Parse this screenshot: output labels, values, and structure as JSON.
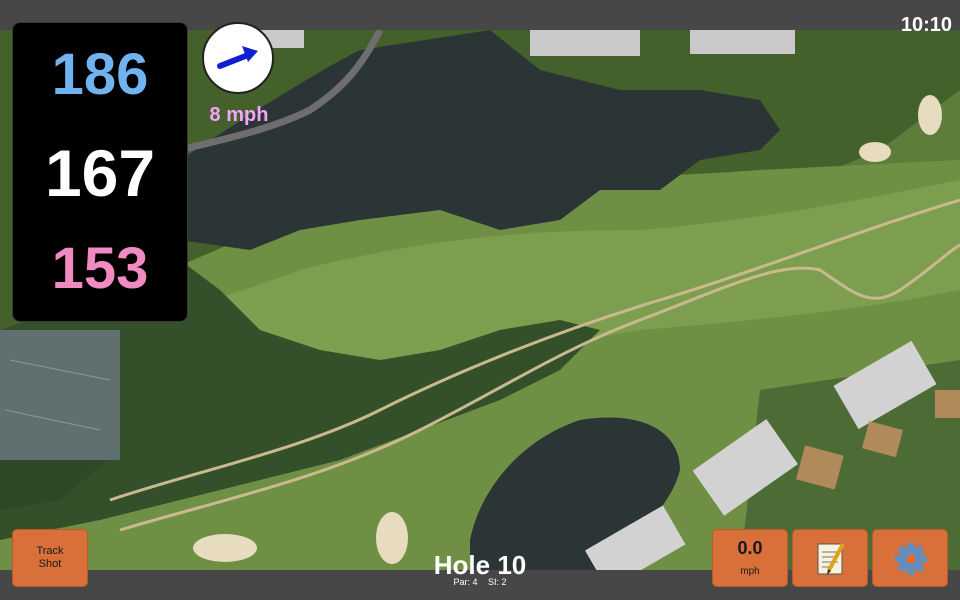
{
  "status": {
    "time": "10:10"
  },
  "distances": {
    "back": "186",
    "center": "167",
    "front": "153"
  },
  "wind": {
    "speed_label": "8 mph",
    "icon": "wind-direction-arrow-icon"
  },
  "buttons": {
    "track_shot": "Track\nShot",
    "wind_value": "0.0",
    "wind_unit": "mph",
    "notes_icon": "notepad-icon",
    "settings_icon": "gear-icon"
  },
  "hole": {
    "title": "Hole 10",
    "par": "Par: 4",
    "si": "SI: 2"
  },
  "colors": {
    "back": "#6fb3f0",
    "center": "#ffffff",
    "front": "#f08ac0",
    "wind_label": "#f3a6ff",
    "button": "#d9703a",
    "arrow": "#1020d0"
  }
}
